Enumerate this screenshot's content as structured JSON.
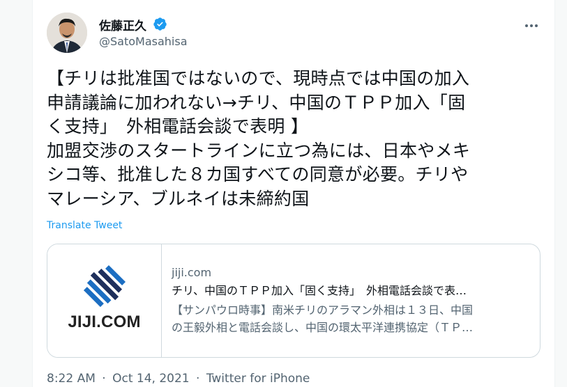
{
  "author": {
    "display_name": "佐藤正久",
    "handle": "@SatoMasahisa",
    "verified": true
  },
  "tweet": {
    "lines": [
      "【チリは批准国ではないので、現時点では中国の加入",
      "申請議論に加われない→チリ、中国のＴＰＰ加入「固",
      "く支持」　外相電話会談で表明 】",
      "加盟交渉のスタートラインに立つ為には、日本やメキ",
      "シコ等、批准した８カ国すべての同意が必要。チリや",
      "マレーシア、ブルネイは未締約国"
    ],
    "translate_label": "Translate Tweet"
  },
  "link_card": {
    "logo_text": "JIJI.COM",
    "domain": "jiji.com",
    "title": "チリ、中国のＴＰＰ加入「固く支持」　外相電話会談で表…",
    "description_lines": [
      "【サンパウロ時事】南米チリのアラマン外相は１３日、中国",
      "の王毅外相と電話会談し、中国の環太平洋連携協定（ＴＰ…"
    ]
  },
  "meta": {
    "time": "8:22 AM",
    "date": "Oct 14, 2021",
    "source": "Twitter for iPhone",
    "separator": "·"
  },
  "colors": {
    "accent": "#1d9bf0",
    "text_primary": "#0f1419",
    "text_secondary": "#536471",
    "border": "#cfd9de",
    "logo_blue": "#1c6ec2",
    "logo_navy": "#1e2f5c"
  },
  "icons": {
    "verified": "verified-badge-icon",
    "more": "more-horizontal-icon"
  }
}
